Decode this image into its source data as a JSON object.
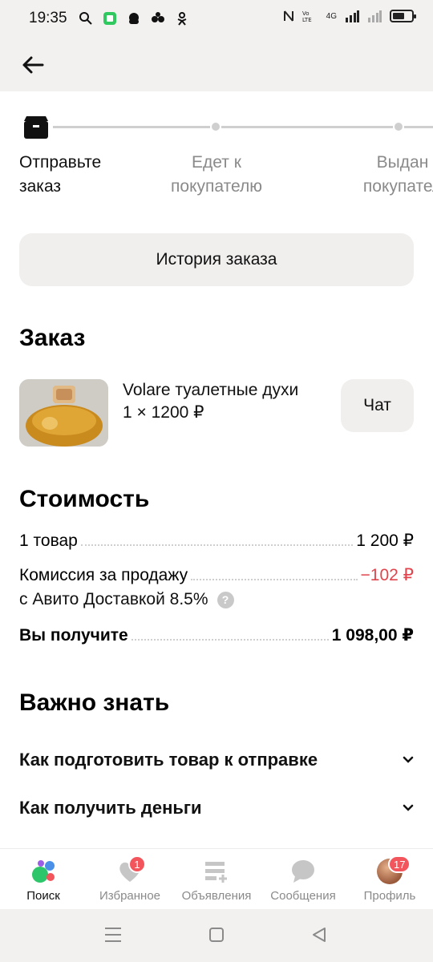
{
  "status_bar": {
    "time": "19:35",
    "network": "4G"
  },
  "progress": {
    "steps": [
      {
        "label": "Отправьте\nзаказ",
        "active": true
      },
      {
        "label": "Едет к\nпокупателю",
        "active": false
      },
      {
        "label": "Выдан\nпокупател",
        "active": false
      }
    ]
  },
  "history_button": "История заказа",
  "order": {
    "title": "Заказ",
    "product_name": "Volare туалетные духи",
    "quantity_price": "1 × 1200 ₽",
    "chat_button": "Чат"
  },
  "cost": {
    "title": "Стоимость",
    "items_label": "1 товар",
    "items_value": "1 200 ₽",
    "commission_label_line1": "Комиссия за продажу",
    "commission_label_line2": "с Авито Доставкой 8.5%",
    "commission_value": "−102 ₽",
    "total_label": "Вы получите",
    "total_value": "1 098,00 ₽",
    "help_icon": "?"
  },
  "important": {
    "title": "Важно знать",
    "items": [
      "Как подготовить товар к отправке",
      "Как получить деньги"
    ]
  },
  "bottom_nav": {
    "items": [
      {
        "label": "Поиск",
        "icon": "search-dots-icon",
        "badge": ""
      },
      {
        "label": "Избранное",
        "icon": "heart-icon",
        "badge": "1"
      },
      {
        "label": "Объявления",
        "icon": "listings-icon",
        "badge": ""
      },
      {
        "label": "Сообщения",
        "icon": "chat-bubble-icon",
        "badge": ""
      },
      {
        "label": "Профиль",
        "icon": "avatar",
        "badge": "17"
      }
    ]
  },
  "colors": {
    "accent_red": "#e0454d",
    "badge_red": "#f3555d",
    "surface_gray": "#f0efee"
  }
}
